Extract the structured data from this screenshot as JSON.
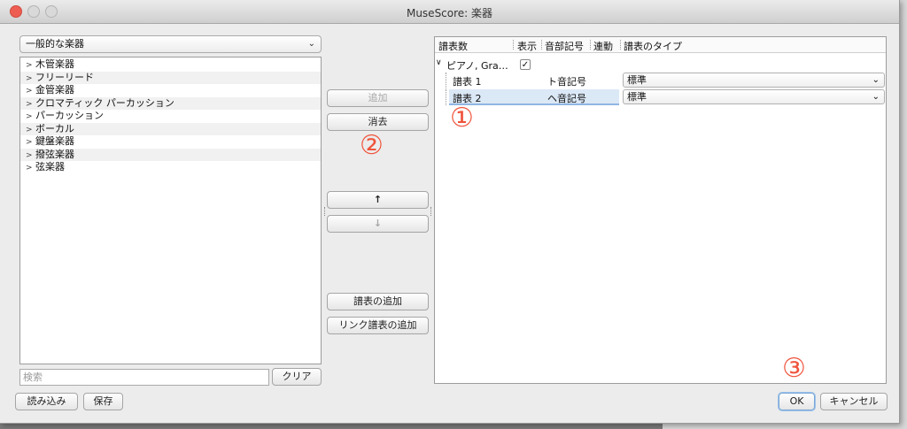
{
  "window": {
    "title": "MuseScore: 楽器"
  },
  "left": {
    "category_select": "一般的な楽器",
    "tree_items": [
      "木管楽器",
      "フリーリード",
      "金管楽器",
      "クロマティック パーカッション",
      "パーカッション",
      "ボーカル",
      "鍵盤楽器",
      "撥弦楽器",
      "弦楽器"
    ],
    "search_placeholder": "検索",
    "clear_label": "クリア"
  },
  "middle": {
    "add_label": "追加",
    "remove_label": "消去",
    "up_label": "↑",
    "down_label": "↓",
    "add_staff_label": "譜表の追加",
    "add_linked_staff_label": "リンク譜表の追加"
  },
  "right": {
    "columns": [
      "譜表数",
      "表示",
      "音部記号",
      "連動",
      "譜表のタイプ"
    ],
    "instrument": {
      "name": "ピアノ, Gra…",
      "visible": true
    },
    "staves": [
      {
        "name": "譜表 1",
        "clef": "ト音記号",
        "type": "標準"
      },
      {
        "name": "譜表 2",
        "clef": "ヘ音記号",
        "type": "標準"
      }
    ]
  },
  "bottom": {
    "load_label": "読み込み",
    "save_label": "保存",
    "ok_label": "OK",
    "cancel_label": "キャンセル"
  },
  "annotations": [
    "①",
    "②",
    "③"
  ]
}
